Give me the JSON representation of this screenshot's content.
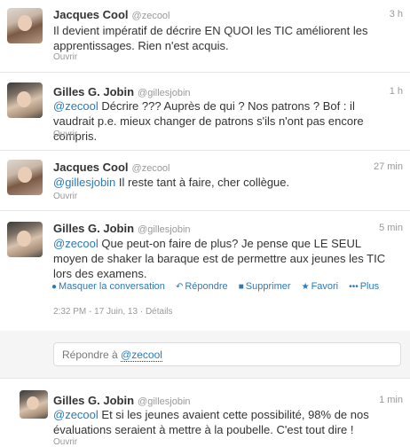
{
  "tweets": [
    {
      "name": "Jacques Cool",
      "handle": "@zecool",
      "time": "3 h",
      "text": "Il devient impératif de décrire EN QUOI les TIC améliorent les apprentissages. Rien n'est acquis.",
      "open": "Ouvrir"
    },
    {
      "name": "Gilles G. Jobin",
      "handle": "@gillesjobin",
      "time": "1 h",
      "mention": "@zecool",
      "text": " Décrire ??? Auprès de qui ? Nos patrons ? Bof : il vaudrait p.e. mieux changer de patrons s'ils n'ont pas encore compris.",
      "open": "Ouvrir"
    },
    {
      "name": "Jacques Cool",
      "handle": "@zecool",
      "time": "27 min",
      "mention": "@gillesjobin",
      "text": " Il reste tant à faire, cher collègue.",
      "open": "Ouvrir"
    },
    {
      "name": "Gilles G. Jobin",
      "handle": "@gillesjobin",
      "time": "5 min",
      "mention": "@zecool",
      "text": " Que peut-on faire de plus? Je pense que LE SEUL moyen de shaker la baraque est de  permettre aux jeunes les TIC lors des examens."
    },
    {
      "name": "Gilles G. Jobin",
      "handle": "@gillesjobin",
      "time": "1 min",
      "mention": "@zecool",
      "text": " Et si les jeunes avaient cette possibilité, 98% de nos évaluations seraient à mettre à la poubelle. C'est tout dire !",
      "open": "Ouvrir"
    }
  ],
  "actions": {
    "hide": "Masquer la conversation",
    "reply": "Répondre",
    "delete": "Supprimer",
    "favorite": "Favori",
    "more": "Plus"
  },
  "details": {
    "timestamp": "2:32 PM - 17 Juin, 13",
    "separator": " · ",
    "link": "Détails"
  },
  "reply": {
    "prefix": "Répondre à ",
    "mention": "@zecool"
  }
}
